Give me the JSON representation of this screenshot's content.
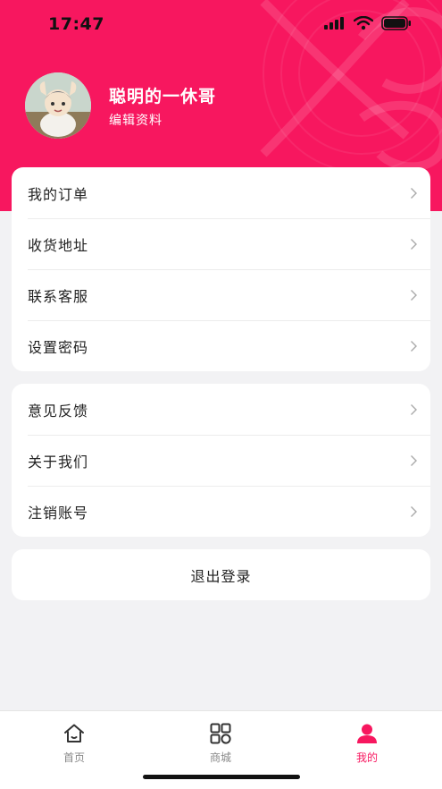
{
  "status_bar": {
    "time": "17:47"
  },
  "profile": {
    "name": "聪明的一休哥",
    "edit_label": "编辑资料"
  },
  "menu_group_1": [
    {
      "label": "我的订单"
    },
    {
      "label": "收货地址"
    },
    {
      "label": "联系客服"
    },
    {
      "label": "设置密码"
    }
  ],
  "menu_group_2": [
    {
      "label": "意见反馈"
    },
    {
      "label": "关于我们"
    },
    {
      "label": "注销账号"
    }
  ],
  "logout_label": "退出登录",
  "tabs": [
    {
      "label": "首页",
      "icon": "home-icon",
      "active": false
    },
    {
      "label": "商城",
      "icon": "grid-icon",
      "active": false
    },
    {
      "label": "我的",
      "icon": "user-icon",
      "active": true
    }
  ],
  "colors": {
    "accent": "#f7175f",
    "background": "#f2f2f4"
  }
}
